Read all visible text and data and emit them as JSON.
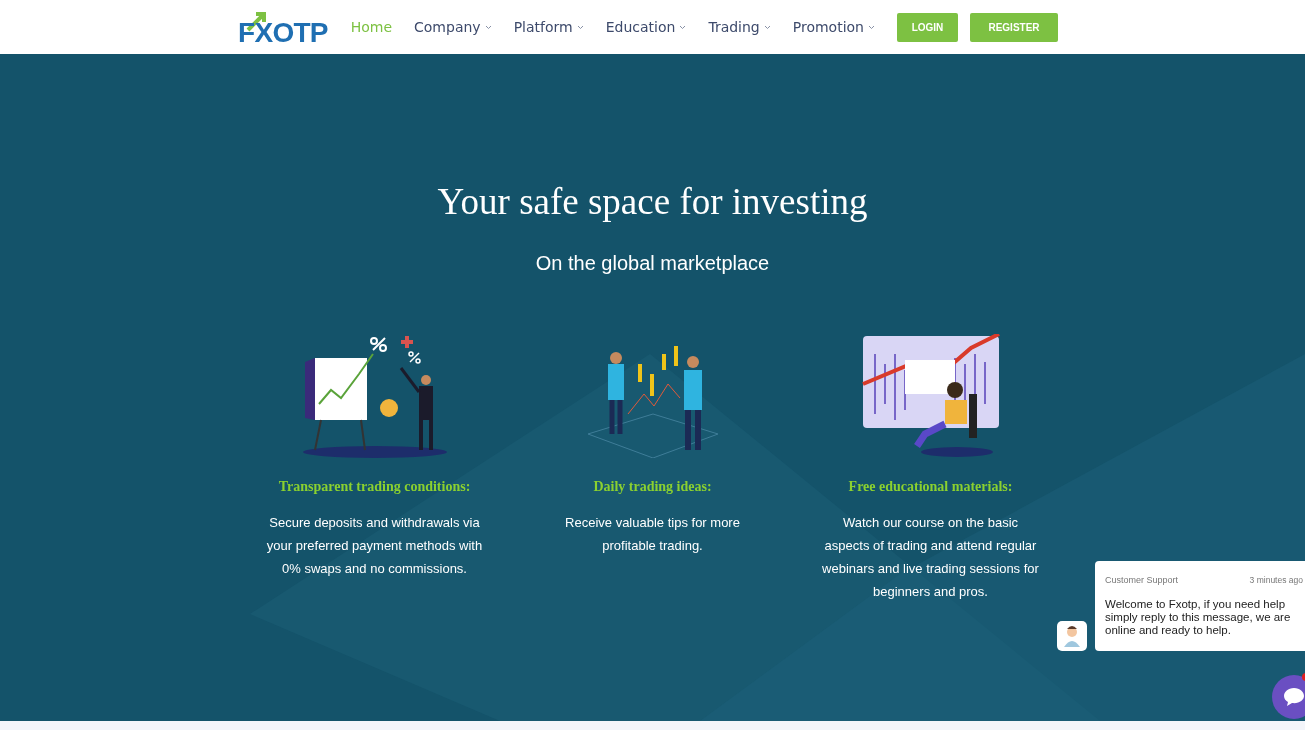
{
  "header": {
    "logo": "FXOTP",
    "nav": [
      {
        "label": "Home",
        "selected": true,
        "dropdown": false
      },
      {
        "label": "Company",
        "selected": false,
        "dropdown": true
      },
      {
        "label": "Platform",
        "selected": false,
        "dropdown": true
      },
      {
        "label": "Education",
        "selected": false,
        "dropdown": true
      },
      {
        "label": "Trading",
        "selected": false,
        "dropdown": true
      },
      {
        "label": "Promotion",
        "selected": false,
        "dropdown": true
      }
    ],
    "buttons": [
      "LOGIN",
      "REGISTER"
    ]
  },
  "hero": {
    "title": "Your safe space for investing",
    "subtitle": "On the global marketplace"
  },
  "features": [
    {
      "kind": "presentation",
      "title": "Transparent trading conditions:",
      "text": "Secure deposits and withdrawals via your preferred payment methods with 0% swaps and no commissions."
    },
    {
      "kind": "traders",
      "title": "Daily trading ideas:",
      "text": "Receive valuable tips for more profitable trading."
    },
    {
      "kind": "analyst",
      "title": "Free educational materials:",
      "text": "Watch our course on the basic aspects of trading and attend regular webinars and live trading sessions for beginners and pros."
    }
  ],
  "chat": {
    "sender": "Customer Support",
    "time": "3 minutes ago",
    "message": "Welcome to Fxotp, if you need help simply reply to this message, we are online and ready to help.",
    "unread": true
  }
}
